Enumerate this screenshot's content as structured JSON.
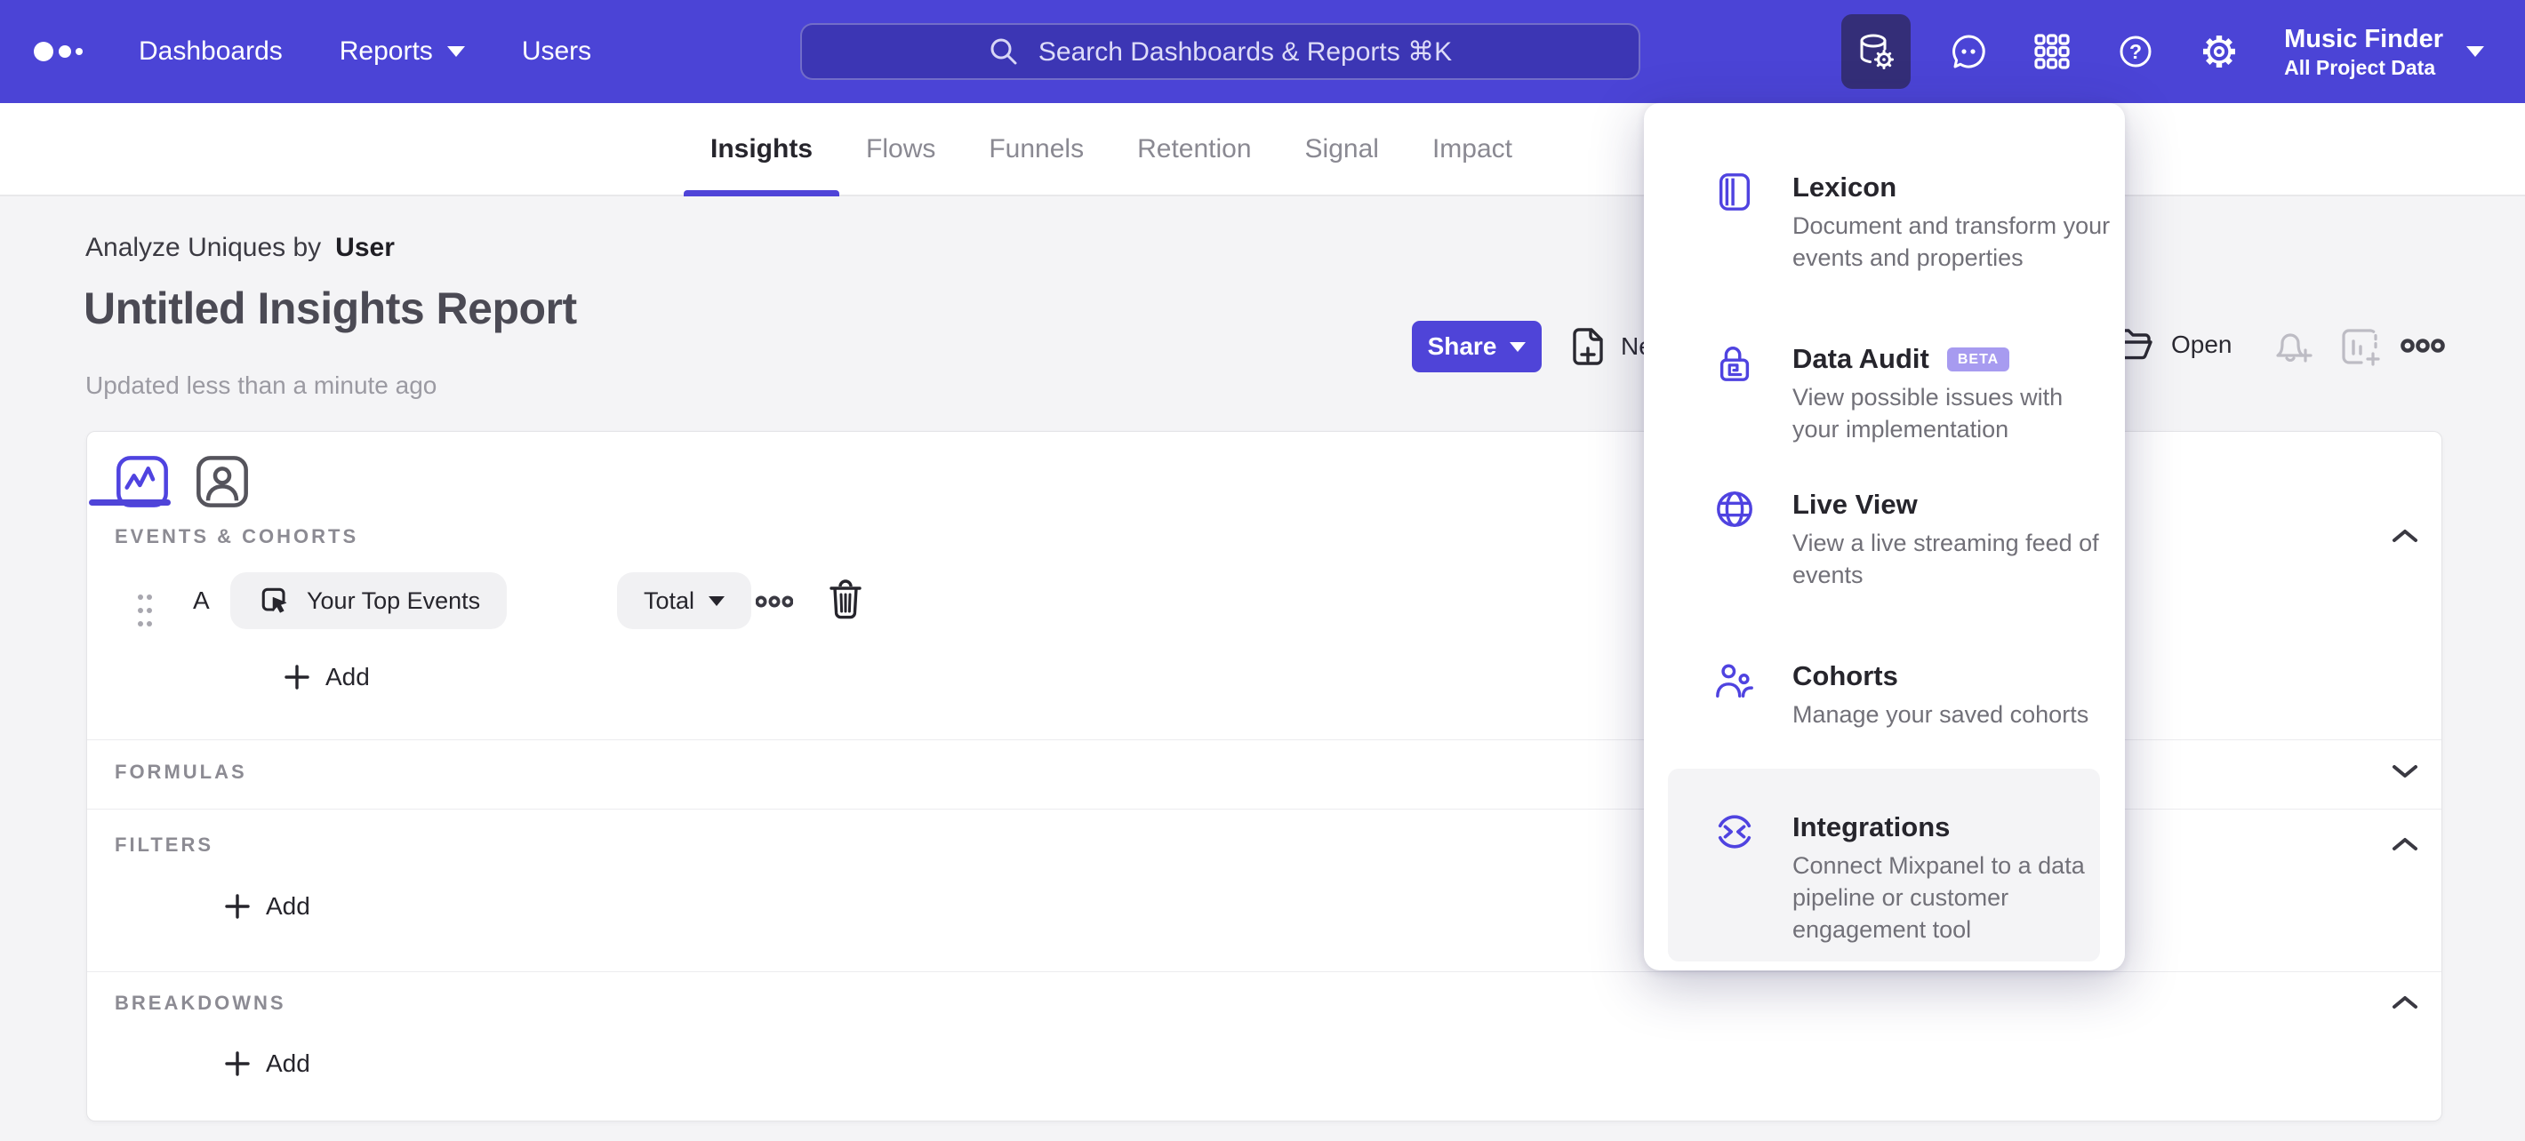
{
  "colors": {
    "header_purple": "#4b44d6",
    "accent_purple": "#4f44d8",
    "icon_purple": "#4f43e0",
    "active_chip_bg": "#342e78",
    "badge_purple": "#a79bf0",
    "page_bg": "#f4f4f6"
  },
  "header": {
    "nav": [
      {
        "label": "Dashboards"
      },
      {
        "label": "Reports"
      },
      {
        "label": "Users"
      }
    ],
    "search": {
      "placeholder": "Search Dashboards & Reports ⌘K"
    },
    "project": {
      "name": "Music Finder",
      "scope": "All Project Data"
    }
  },
  "tabs": {
    "items": [
      {
        "label": "Insights"
      },
      {
        "label": "Flows"
      },
      {
        "label": "Funnels"
      },
      {
        "label": "Retention"
      },
      {
        "label": "Signal"
      },
      {
        "label": "Impact"
      }
    ],
    "active": "Insights"
  },
  "report": {
    "context_prefix": "Analyze Uniques by",
    "context_value": "User",
    "title": "Untitled Insights Report",
    "updated": "Updated less than a minute ago",
    "share_label": "Share",
    "new_label": "New",
    "open_label": "Open"
  },
  "builder": {
    "sections": {
      "events": "EVENTS & COHORTS",
      "formulas": "FORMULAS",
      "filters": "FILTERS",
      "breakdowns": "BREAKDOWNS"
    },
    "event_row": {
      "letter": "A",
      "event": "Your Top Events",
      "aggregation": "Total"
    },
    "add_label": "Add"
  },
  "menu": {
    "items": [
      {
        "title": "Lexicon",
        "desc": "Document and transform your events and properties"
      },
      {
        "title": "Data Audit",
        "badge": "BETA",
        "desc": "View possible issues with your implementation"
      },
      {
        "title": "Live View",
        "desc": "View a live streaming feed of events"
      },
      {
        "title": "Cohorts",
        "desc": "Manage your saved cohorts"
      },
      {
        "title": "Integrations",
        "desc": "Connect Mixpanel to a data pipeline or customer engagement tool"
      }
    ]
  }
}
